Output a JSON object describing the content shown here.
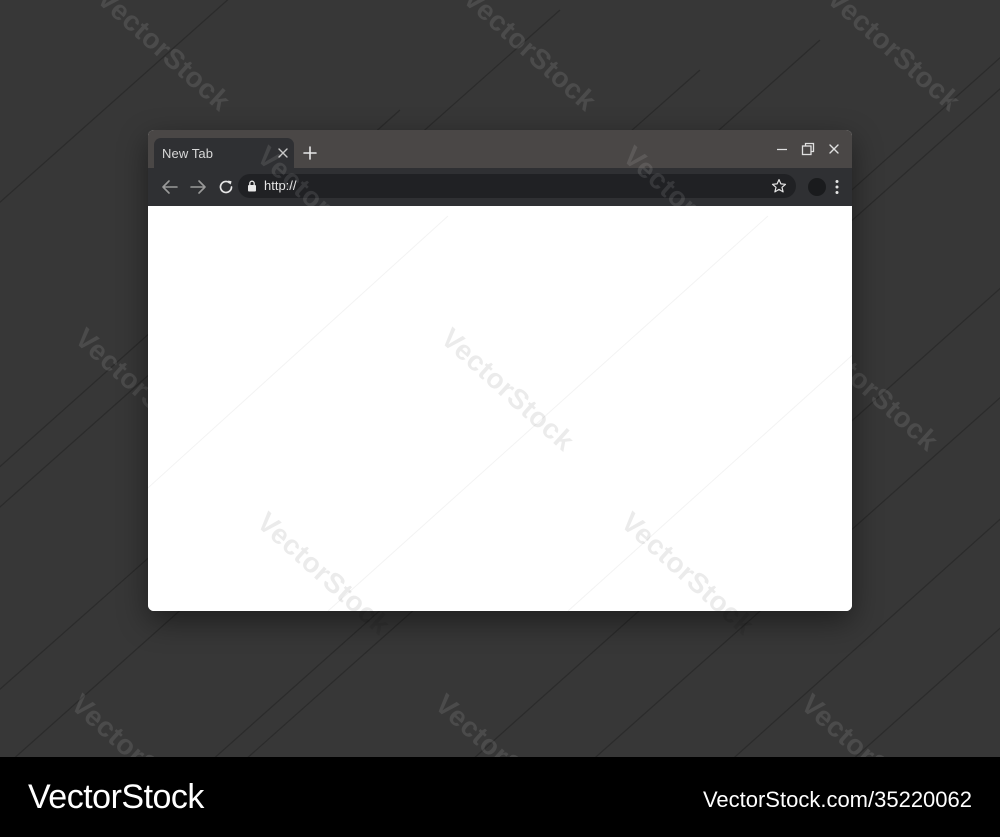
{
  "browser": {
    "tab": {
      "title": "New Tab",
      "close_icon": "close-icon"
    },
    "new_tab_icon": "plus-icon",
    "window_controls": [
      "minimize-icon",
      "restore-icon",
      "close-icon"
    ],
    "toolbar": {
      "back_icon": "arrow-left-icon",
      "forward_icon": "arrow-right-icon",
      "reload_icon": "reload-icon",
      "lock_icon": "lock-icon",
      "url": "http://",
      "bookmark_icon": "star-icon",
      "menu_icon": "kebab-menu-icon"
    }
  },
  "watermark": {
    "text": "VectorStock"
  },
  "footer": {
    "logo": "VectorStock",
    "image_id": "VectorStock.com/35220062"
  },
  "colors": {
    "backdrop": "#373737",
    "tabstrip": "#4a4746",
    "toolbar": "#2f3033",
    "omnibox": "#202124",
    "content": "#ffffff",
    "footer": "#000000"
  }
}
